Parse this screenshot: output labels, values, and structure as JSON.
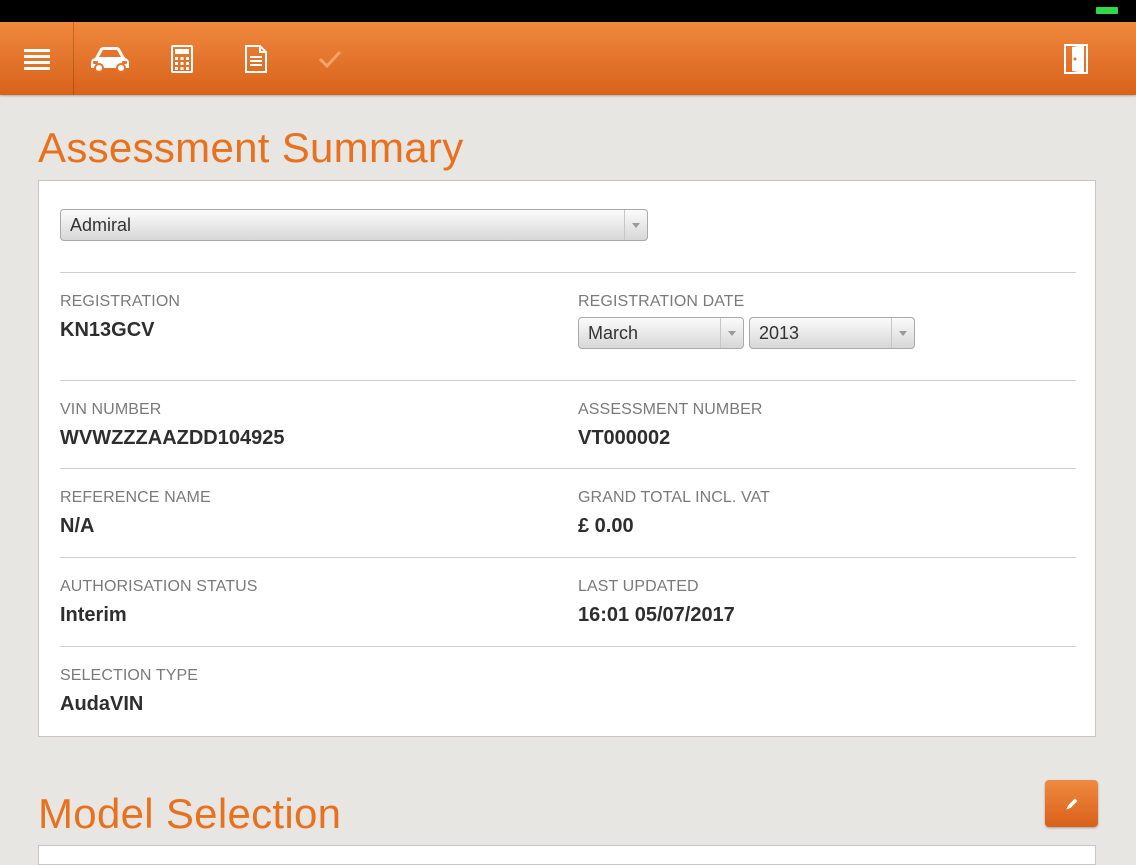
{
  "colors": {
    "accent": "#e8711e",
    "toolbar": "#e5742a",
    "background": "#e8e6e3"
  },
  "toolbar": {
    "icons": [
      "menu-icon",
      "car-icon",
      "calculator-icon",
      "document-icon",
      "checkmark-icon",
      "exit-door-icon"
    ]
  },
  "assessment": {
    "title": "Assessment Summary",
    "insurer_select": "Admiral",
    "registration_label": "REGISTRATION",
    "registration_value": "KN13GCV",
    "registration_date_label": "REGISTRATION DATE",
    "reg_month": "March",
    "reg_year": "2013",
    "vin_label": "VIN NUMBER",
    "vin_value": "WVWZZZAAZDD104925",
    "assessment_number_label": "ASSESSMENT NUMBER",
    "assessment_number_value": "VT000002",
    "reference_name_label": "REFERENCE NAME",
    "reference_name_value": "N/A",
    "grand_total_label": "GRAND TOTAL INCL. VAT",
    "grand_total_value": "£ 0.00",
    "authorisation_status_label": "AUTHORISATION STATUS",
    "authorisation_status_value": "Interim",
    "last_updated_label": "LAST UPDATED",
    "last_updated_value": "16:01 05/07/2017",
    "selection_type_label": "SELECTION TYPE",
    "selection_type_value": "AudaVIN"
  },
  "model_selection": {
    "title": "Model Selection"
  }
}
